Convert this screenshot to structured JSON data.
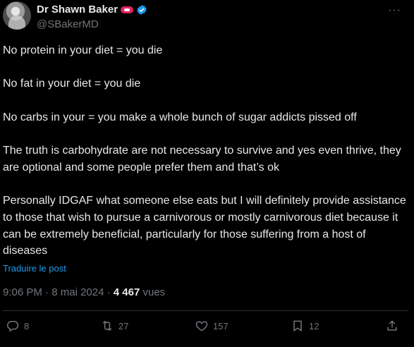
{
  "author": {
    "name": "Dr Shawn Baker",
    "handle": "@SBakerMD"
  },
  "post": {
    "paragraphs": [
      "No protein in your diet = you die",
      "No fat in your diet = you die",
      "No carbs in your = you make a whole bunch of sugar addicts pissed off",
      "The truth is carbohydrate are not necessary to survive and yes even thrive, they are optional and some people prefer them and that’s ok",
      "Personally IDGAF what someone else eats but I will definitely provide assistance to those that wish to pursue a carnivorous or mostly carnivorous diet because it can be extremely beneficial, particularly for those suffering from a host of diseases"
    ],
    "translate_label": "Traduire le post",
    "time": "9:06 PM",
    "date": "8 mai 2024",
    "separator": "·",
    "views_count": "4 467",
    "views_label": "vues"
  },
  "actions": {
    "replies": "8",
    "reposts": "27",
    "likes": "157",
    "bookmarks": "12"
  },
  "colors": {
    "background": "#000000",
    "text": "#e7e9ea",
    "muted": "#71767b",
    "link": "#1d9bf0",
    "verified": "#1d9bf0"
  },
  "icons": [
    "avatar",
    "flag-emoji-icon",
    "verified-badge-icon",
    "more-icon",
    "reply-icon",
    "repost-icon",
    "like-icon",
    "bookmark-icon",
    "share-icon"
  ]
}
